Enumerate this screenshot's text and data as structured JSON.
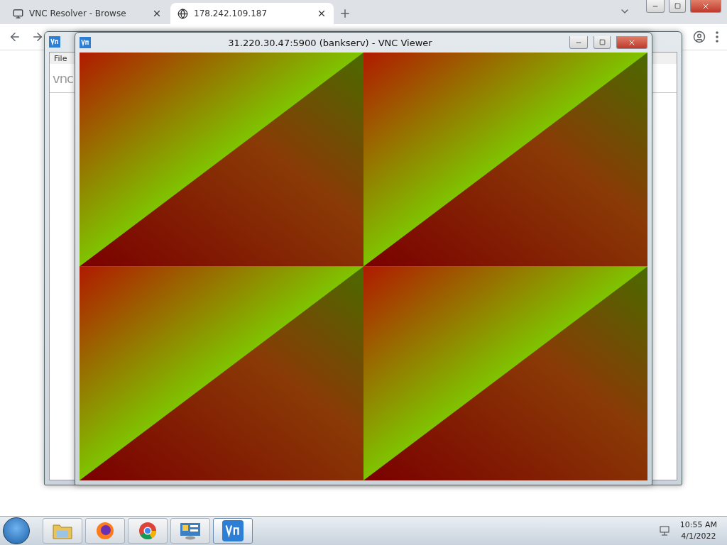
{
  "browser": {
    "tabs": [
      {
        "title": "VNC Resolver - Browse",
        "kind": "resolver",
        "selected": false
      },
      {
        "title": "178.242.109.187",
        "kind": "globe",
        "selected": true
      }
    ]
  },
  "back_window": {
    "menu": [
      "File"
    ],
    "logo": "vnc"
  },
  "viewer": {
    "title": "31.220.30.47:5900 (bankserv) - VNC Viewer"
  },
  "taskbar": {
    "apps": [
      {
        "kind": "folder",
        "selected": false
      },
      {
        "kind": "firefox",
        "selected": false
      },
      {
        "kind": "chrome",
        "selected": false
      },
      {
        "kind": "control-panel",
        "selected": false
      },
      {
        "kind": "vnc",
        "selected": true
      }
    ],
    "clock": {
      "time": "10:55 AM",
      "date": "4/1/2022"
    }
  }
}
